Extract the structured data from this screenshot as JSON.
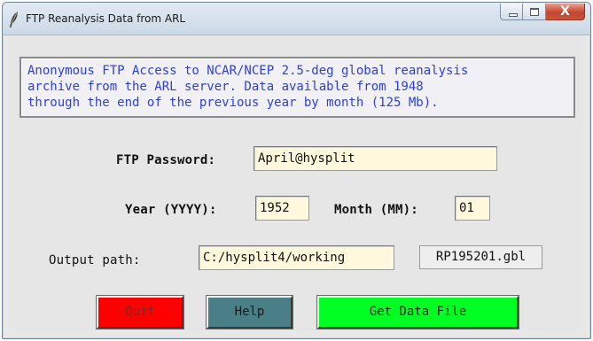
{
  "window": {
    "title": "FTP Reanalysis Data from ARL",
    "icon": "feather-pen-icon",
    "controls": {
      "minimize": "minimize-icon",
      "maximize": "maximize-icon",
      "close": "close-icon"
    }
  },
  "info": {
    "text": "Anonymous FTP Access to NCAR/NCEP 2.5-deg global reanalysis\narchive from the ARL server. Data available from 1948\nthrough the end of the previous year by month (125 Mb).",
    "color": "#2f3fd8"
  },
  "form": {
    "password": {
      "label": "FTP Password:",
      "value": "April@hysplit"
    },
    "year": {
      "label": "Year (YYYY):",
      "value": "1952"
    },
    "month": {
      "label": "Month (MM):",
      "value": "01"
    },
    "output_path": {
      "label": "Output path:",
      "value": "C:/hysplit4/working"
    },
    "output_file": "RP195201.gbl",
    "field_bg": "#fff8dc"
  },
  "buttons": {
    "quit": {
      "label": "Quit",
      "bg": "#ff0000",
      "fg": "#7a2a2a"
    },
    "help": {
      "label": "Help",
      "bg": "#4a7f88",
      "fg": "#1a1a1a"
    },
    "get": {
      "label": "Get Data File",
      "bg": "#00ff22",
      "fg": "#1a1a1a"
    }
  }
}
